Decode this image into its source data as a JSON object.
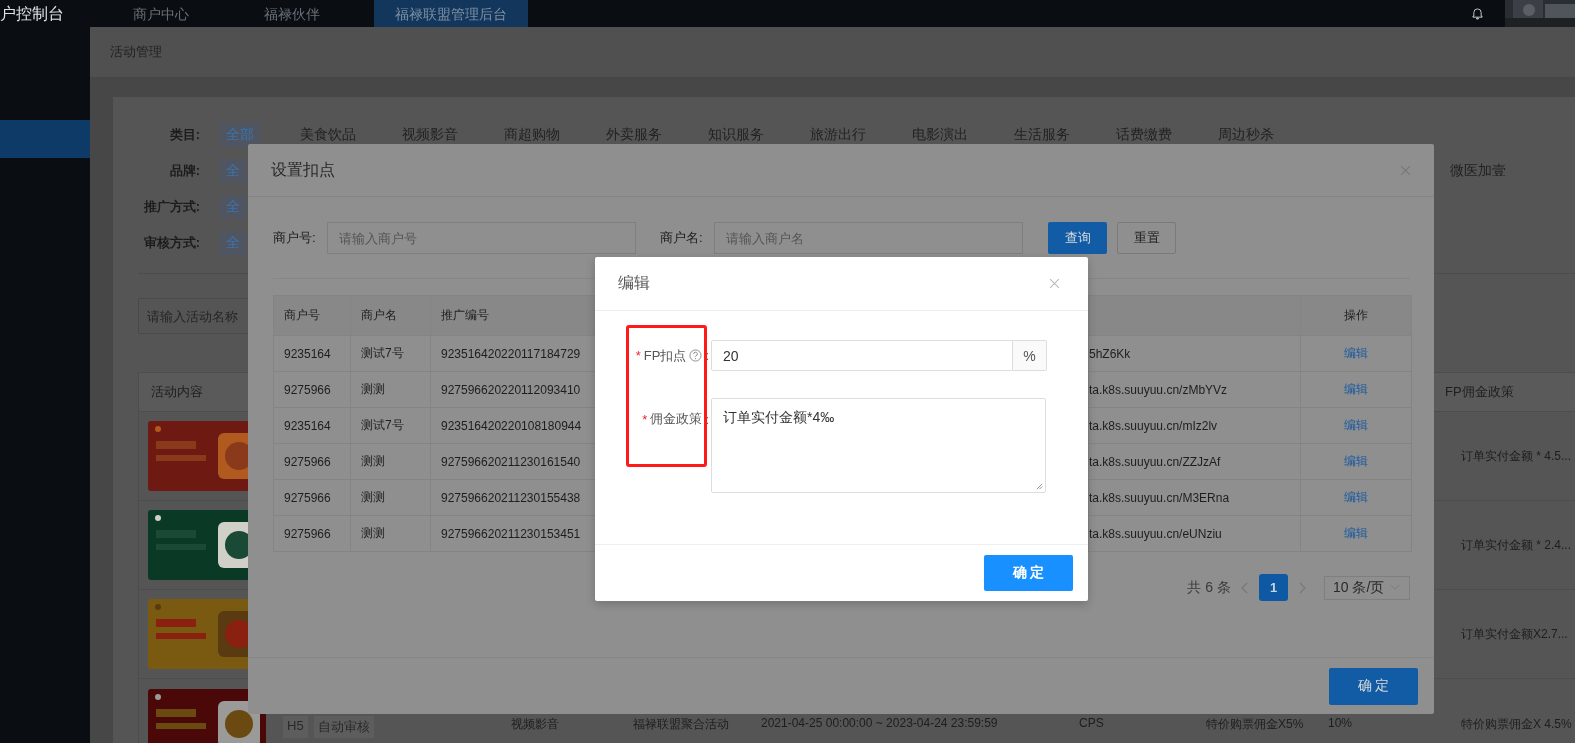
{
  "top_bar": {
    "brand": "户控制台",
    "tabs": [
      {
        "label": "商户中心",
        "selected": false
      },
      {
        "label": "福禄伙伴",
        "selected": false
      },
      {
        "label": "福禄联盟管理后台",
        "selected": true
      }
    ]
  },
  "sidebar": {
    "items": [
      {
        "selected": true
      }
    ]
  },
  "breadcrumb": "活动管理",
  "filters": [
    {
      "label": "类目:",
      "options": [
        {
          "label": "全部",
          "selected": true
        },
        {
          "label": "美食饮品",
          "selected": false
        },
        {
          "label": "视频影音",
          "selected": false
        },
        {
          "label": "商超购物",
          "selected": false
        },
        {
          "label": "外卖服务",
          "selected": false
        },
        {
          "label": "知识服务",
          "selected": false
        },
        {
          "label": "旅游出行",
          "selected": false
        },
        {
          "label": "电影演出",
          "selected": false
        },
        {
          "label": "生活服务",
          "selected": false
        },
        {
          "label": "话费缴费",
          "selected": false
        },
        {
          "label": "周边秒杀",
          "selected": false
        }
      ]
    },
    {
      "label": "品牌:",
      "options": [
        {
          "label": "全",
          "selected": true
        },
        {
          "label": "微医加壹",
          "selected": false
        }
      ]
    },
    {
      "label": "推广方式:",
      "options": [
        {
          "label": "全",
          "selected": true
        }
      ]
    },
    {
      "label": "审核方式:",
      "options": [
        {
          "label": "全",
          "selected": true
        }
      ]
    }
  ],
  "activity_search": {
    "placeholder": "请输入活动名称"
  },
  "activity_table": {
    "columns": [
      {
        "label": "活动内容"
      },
      {
        "label": "FP佣金政策"
      }
    ],
    "rows": [
      {
        "content": {
          "kind": "picture"
        },
        "fp_policy": "订单实付金额 * 4.5..."
      },
      {
        "content": {
          "kind": "picture"
        },
        "fp_policy": "订单实付金额 * 2.4..."
      },
      {
        "content": {
          "kind": "picture"
        },
        "fp_policy": "订单实付金额X2.7..."
      },
      {
        "content": {
          "kind": "picture"
        },
        "tags": [
          "H5",
          "自动审核"
        ],
        "column_3": "视频影音",
        "column_4": "福禄联盟聚合活动",
        "column_5": "2021-04-25 00:00:00 ~ 2023-04-24 23:59:59",
        "column_6": "CPS",
        "column_7": "特价购票佣金X5%",
        "column_8": "10%",
        "fp_policy": "特价购票佣金X 4.5%"
      }
    ]
  },
  "deduction_dialog": {
    "title": "设置扣点",
    "search": [
      {
        "label": "商户号:",
        "placeholder": "请输入商户号"
      },
      {
        "label": "商户名:",
        "placeholder": "请输入商户名"
      }
    ],
    "buttons": [
      {
        "label": "查询",
        "kind": "primary"
      },
      {
        "label": "重置",
        "kind": "default"
      }
    ],
    "table": {
      "columns": [
        {
          "label": "商户号"
        },
        {
          "label": "商户名"
        },
        {
          "label": "推广编号"
        },
        {
          "label": "操作"
        }
      ],
      "rows": [
        {
          "merchant_no": "9235164",
          "merchant_name": "测试7号",
          "promo_no": "923516420220117184729",
          "link": "5hZ6Kk",
          "action": "编辑"
        },
        {
          "merchant_no": "9275966",
          "merchant_name": "测测",
          "promo_no": "927596620220112093410",
          "link": "ta.k8s.suuyuu.cn/zMbYVz",
          "action": "编辑"
        },
        {
          "merchant_no": "9235164",
          "merchant_name": "测试7号",
          "promo_no": "923516420220108180944",
          "link": "ta.k8s.suuyuu.cn/mIz2lv",
          "action": "编辑"
        },
        {
          "merchant_no": "9275966",
          "merchant_name": "测测",
          "promo_no": "927596620211230161540",
          "link": "ta.k8s.suuyuu.cn/ZZJzAf",
          "action": "编辑"
        },
        {
          "merchant_no": "9275966",
          "merchant_name": "测测",
          "promo_no": "927596620211230155438",
          "link": "ta.k8s.suuyuu.cn/M3ERna",
          "action": "编辑"
        },
        {
          "merchant_no": "9275966",
          "merchant_name": "测测",
          "promo_no": "927596620211230153451",
          "link": "ta.k8s.suuyuu.cn/eUNziu",
          "action": "编辑"
        }
      ]
    },
    "pagination": {
      "total": "共 6 条",
      "pages": [
        {
          "label": "1",
          "selected": true
        }
      ],
      "page_size": "10 条/页"
    },
    "confirm": "确 定"
  },
  "edit_dialog": {
    "title": "编辑",
    "fields": [
      {
        "kind": "input",
        "required_mark": "*",
        "label": "FP扣点",
        "help": true,
        "colon": ":",
        "value": "20",
        "suffix": "%"
      },
      {
        "kind": "textarea",
        "required_mark": "*",
        "label": "佣金政策",
        "help": false,
        "colon": ":",
        "value": "订单实付金额*4‰"
      }
    ],
    "confirm": "确 定"
  },
  "annotation": {
    "kind": "frame"
  }
}
